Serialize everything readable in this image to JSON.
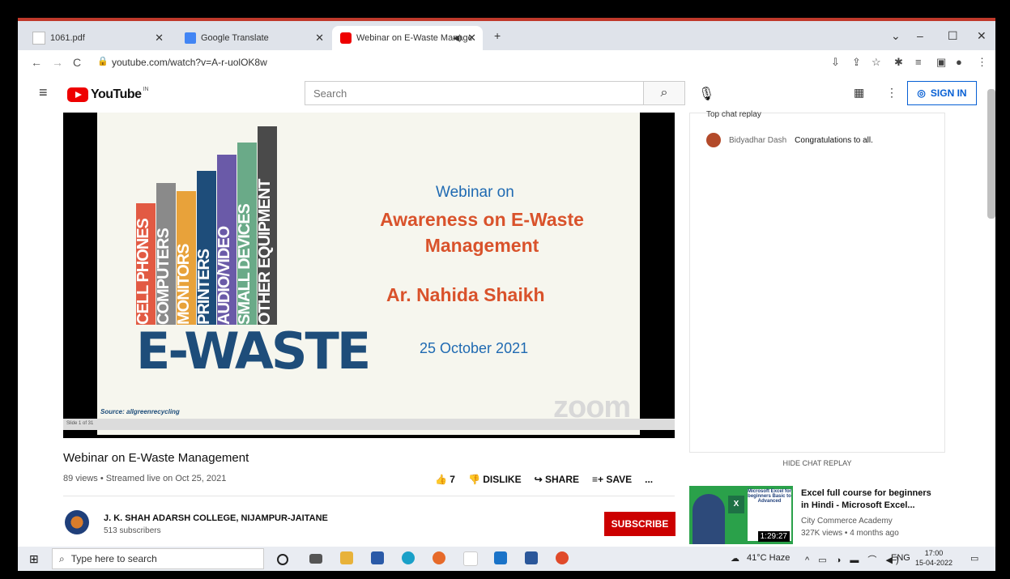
{
  "browser": {
    "tabs": [
      {
        "label": "1061.pdf"
      },
      {
        "label": "Google Translate"
      },
      {
        "label": "Webinar on E-Waste Manage"
      }
    ],
    "new_tab": "+",
    "url": "youtube.com/watch?v=A-r-uolOK8w",
    "window_controls": {
      "minimize": "–",
      "maximize": "☐",
      "close": "✕",
      "dropdown": "⌄"
    }
  },
  "youtube": {
    "logo": "YouTube",
    "region": "IN",
    "search_placeholder": "Search",
    "sign_in": "SIGN IN"
  },
  "slide": {
    "categories": [
      "CELL PHONES",
      "COMPUTERS",
      "MONITORS",
      "PRINTERS",
      "AUDIO/VIDEO",
      "SMALL DEVICES",
      "OTHER EQUIPMENT"
    ],
    "colors": [
      "#e25a43",
      "#8a8a8a",
      "#e8a23a",
      "#1e4d7a",
      "#6a5aa8",
      "#6aaa88",
      "#4a4a4a"
    ],
    "ewaste": "E-WASTE",
    "source": "Source: allgreenrecycling",
    "line1": "Webinar on",
    "line2": "Awareness on E-Waste Management",
    "line3": "Ar. Nahida Shaikh",
    "line4": "25 October 2021",
    "watermark": "zoom",
    "slide_no": "Slide 1 of 31"
  },
  "video": {
    "title": "Webinar on E-Waste Management",
    "meta": "89 views • Streamed live on Oct 25, 2021",
    "likes": "7",
    "dislike": "DISLIKE",
    "share": "SHARE",
    "save": "SAVE",
    "more": "..."
  },
  "channel": {
    "name": "J. K. SHAH ADARSH COLLEGE, NIJAMPUR-JAITANE",
    "subscribers": "513 subscribers",
    "subscribe": "SUBSCRIBE"
  },
  "chat": {
    "header": "Top chat replay",
    "messages": [
      {
        "author": "Bidyadhar Dash",
        "text": "Congratulations to all."
      }
    ],
    "hide": "HIDE CHAT REPLAY"
  },
  "recommended": [
    {
      "title": "Excel full course for beginners in Hindi - Microsoft Excel...",
      "channel": "City Commerce Academy",
      "views": "327K views • 4 months ago",
      "duration": "1:29:27",
      "thumb_text": "Microsoft Excel for beginners Basic to Advanced"
    }
  ],
  "taskbar": {
    "search": "Type here to search",
    "weather": "41°C Haze",
    "lang": "ENG",
    "time": "17:00",
    "date": "15-04-2022"
  }
}
